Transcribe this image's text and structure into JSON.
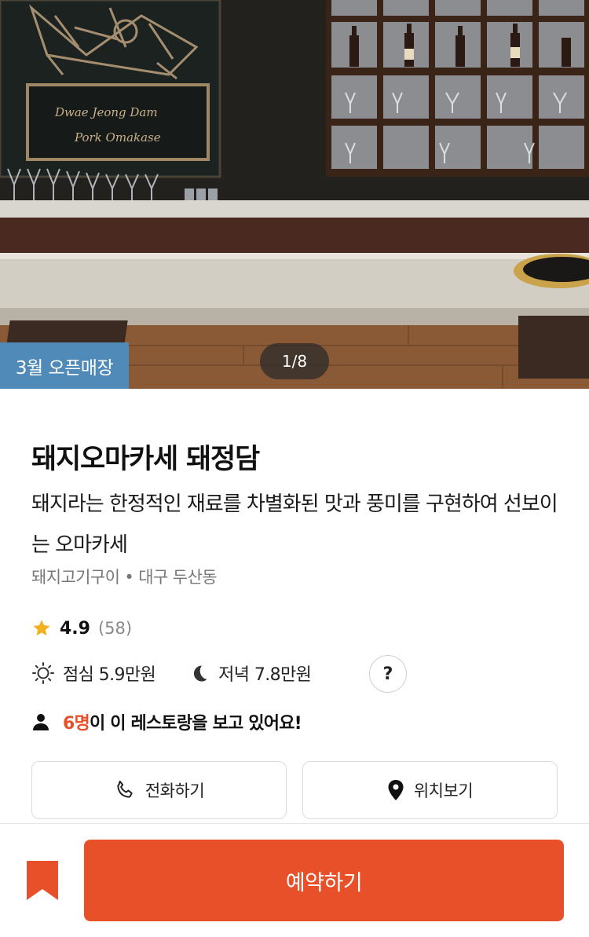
{
  "hero": {
    "badge": "3월 오픈매장",
    "counter": "1/8",
    "sign_line1": "Dwae Jeong Dam",
    "sign_line2": "Pork Omakase"
  },
  "restaurant": {
    "name": "돼지오마카세 돼정담",
    "description": "돼지라는 한정적인 재료를 차별화된 맛과 풍미를 구현하여 선보이는 오마카세",
    "meta": "돼지고기구이 • 대구 두산동",
    "rating": "4.9",
    "review_count": "(58)",
    "lunch_price": "점심 5.9만원",
    "dinner_price": "저녁 7.8만원",
    "help_label": "?"
  },
  "viewers": {
    "count": "6명",
    "text": "이 이 레스토랑을 보고 있어요!"
  },
  "actions": {
    "call_label": "전화하기",
    "map_label": "위치보기"
  },
  "bottom": {
    "reserve_label": "예약하기"
  },
  "colors": {
    "accent": "#e8502a",
    "badge": "#4f8ab9",
    "star": "#f2b01e"
  }
}
